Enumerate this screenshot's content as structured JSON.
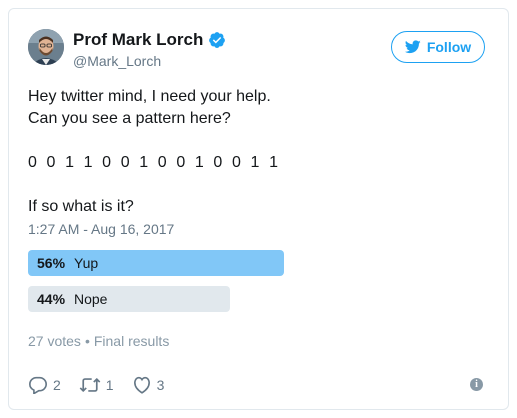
{
  "user": {
    "display_name": "Prof Mark Lorch",
    "screen_name": "@Mark_Lorch",
    "verified": true
  },
  "follow_button": {
    "label": "Follow",
    "icon": "twitter-bird-icon"
  },
  "tweet": {
    "line1": "Hey twitter mind, I need your help.",
    "line2": "Can you see a pattern here?",
    "binary": "0 0 1 1 0 0 1 0 0 1 0 0 1 1",
    "question": "If so what is it?"
  },
  "timestamp": "1:27 AM - Aug 16, 2017",
  "poll": {
    "options": [
      {
        "percent": "56%",
        "label": "Yup",
        "value": 0.56,
        "winner": true
      },
      {
        "percent": "44%",
        "label": "Nope",
        "value": 0.44,
        "winner": false
      }
    ],
    "votes": "27 votes",
    "status": "Final results"
  },
  "actions": {
    "replies": "2",
    "retweets": "1",
    "likes": "3"
  },
  "colors": {
    "accent": "#1da1f2",
    "poll_winner": "#81c7f7",
    "poll_other": "#e1e8ed",
    "muted_text": "#657786"
  }
}
